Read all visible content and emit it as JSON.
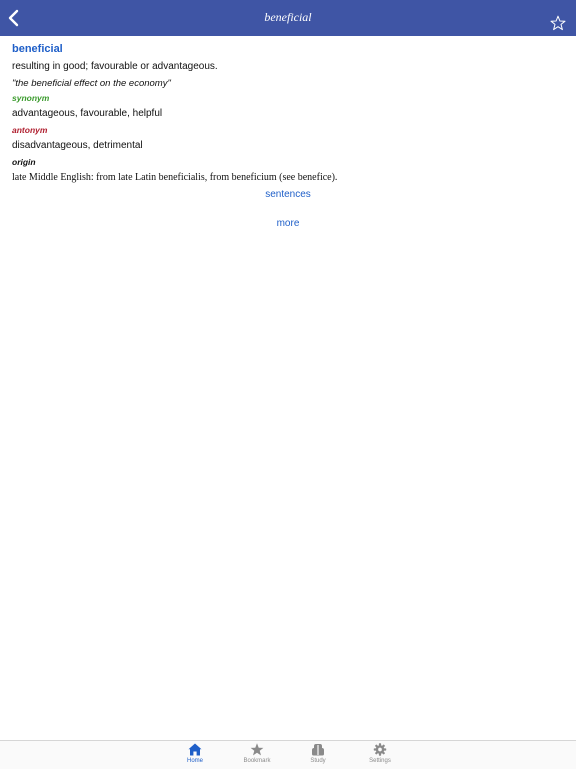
{
  "header": {
    "title": "beneficial"
  },
  "entry": {
    "headword": "beneficial",
    "definition": "resulting in good; favourable or advantageous.",
    "example": "\"the beneficial effect on the economy\"",
    "synonym_label": "synonym",
    "synonyms": "advantageous, favourable, helpful",
    "antonym_label": "antonym",
    "antonyms": "disadvantageous, detrimental",
    "origin_label": "origin",
    "origin": "late Middle English: from late Latin beneficialis, from beneficium (see benefice)."
  },
  "links": {
    "sentences": "sentences",
    "more": "more"
  },
  "tabbar": {
    "items": [
      {
        "label": "Home",
        "icon": "home-icon"
      },
      {
        "label": "Bookmark",
        "icon": "star-icon"
      },
      {
        "label": "Study",
        "icon": "study-icon"
      },
      {
        "label": "Settings",
        "icon": "gear-icon"
      }
    ]
  },
  "colors": {
    "navbar": "#3f55a5",
    "accent": "#1f5fc8",
    "synonym": "#3a9a2c",
    "antonym": "#b02030"
  }
}
